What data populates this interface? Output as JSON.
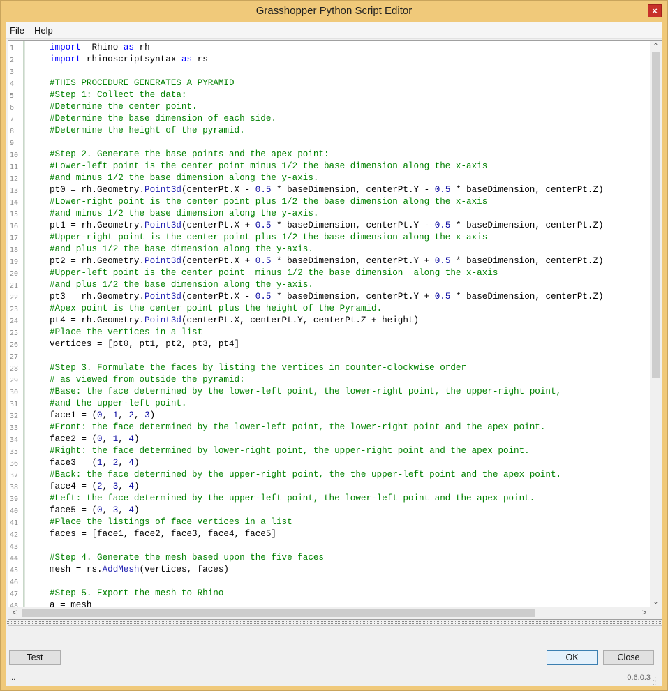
{
  "window": {
    "title": "Grasshopper Python Script Editor",
    "close_glyph": "×"
  },
  "menu": {
    "file": "File",
    "help": "Help"
  },
  "editor": {
    "lines": [
      {
        "n": "1",
        "t": [
          [
            "kw",
            "import"
          ],
          [
            "",
            "  Rhino "
          ],
          [
            "kw",
            "as"
          ],
          [
            "",
            " rh"
          ]
        ]
      },
      {
        "n": "2",
        "t": [
          [
            "kw",
            "import"
          ],
          [
            "",
            " rhinoscriptsyntax "
          ],
          [
            "kw",
            "as"
          ],
          [
            "",
            " rs"
          ]
        ]
      },
      {
        "n": "3",
        "t": []
      },
      {
        "n": "4",
        "t": [
          [
            "cm",
            "#THIS PROCEDURE GENERATES A PYRAMID"
          ]
        ]
      },
      {
        "n": "5",
        "t": [
          [
            "cm",
            "#Step 1: Collect the data:"
          ]
        ]
      },
      {
        "n": "6",
        "t": [
          [
            "cm",
            "#Determine the center point."
          ]
        ]
      },
      {
        "n": "7",
        "t": [
          [
            "cm",
            "#Determine the base dimension of each side."
          ]
        ]
      },
      {
        "n": "8",
        "t": [
          [
            "cm",
            "#Determine the height of the pyramid."
          ]
        ]
      },
      {
        "n": "9",
        "t": []
      },
      {
        "n": "10",
        "t": [
          [
            "cm",
            "#Step 2. Generate the base points and the apex point:"
          ]
        ]
      },
      {
        "n": "11",
        "t": [
          [
            "cm",
            "#Lower-left point is the center point minus 1/2 the base dimension along the x-axis"
          ]
        ]
      },
      {
        "n": "12",
        "t": [
          [
            "cm",
            "#and minus 1/2 the base dimension along the y-axis."
          ]
        ]
      },
      {
        "n": "13",
        "t": [
          [
            "",
            "pt0 = rh.Geometry."
          ],
          [
            "fn",
            "Point3d"
          ],
          [
            "",
            "(centerPt.X - "
          ],
          [
            "num",
            "0.5"
          ],
          [
            "",
            " * baseDimension, centerPt.Y - "
          ],
          [
            "num",
            "0.5"
          ],
          [
            "",
            " * baseDimension, centerPt.Z)"
          ]
        ]
      },
      {
        "n": "14",
        "t": [
          [
            "cm",
            "#Lower-right point is the center point plus 1/2 the base dimension along the x-axis"
          ]
        ]
      },
      {
        "n": "15",
        "t": [
          [
            "cm",
            "#and minus 1/2 the base dimension along the y-axis."
          ]
        ]
      },
      {
        "n": "16",
        "t": [
          [
            "",
            "pt1 = rh.Geometry."
          ],
          [
            "fn",
            "Point3d"
          ],
          [
            "",
            "(centerPt.X + "
          ],
          [
            "num",
            "0.5"
          ],
          [
            "",
            " * baseDimension, centerPt.Y - "
          ],
          [
            "num",
            "0.5"
          ],
          [
            "",
            " * baseDimension, centerPt.Z)"
          ]
        ]
      },
      {
        "n": "17",
        "t": [
          [
            "cm",
            "#Upper-right point is the center point plus 1/2 the base dimension along the x-axis"
          ]
        ]
      },
      {
        "n": "18",
        "t": [
          [
            "cm",
            "#and plus 1/2 the base dimension along the y-axis."
          ]
        ]
      },
      {
        "n": "19",
        "t": [
          [
            "",
            "pt2 = rh.Geometry."
          ],
          [
            "fn",
            "Point3d"
          ],
          [
            "",
            "(centerPt.X + "
          ],
          [
            "num",
            "0.5"
          ],
          [
            "",
            " * baseDimension, centerPt.Y + "
          ],
          [
            "num",
            "0.5"
          ],
          [
            "",
            " * baseDimension, centerPt.Z)"
          ]
        ]
      },
      {
        "n": "20",
        "t": [
          [
            "cm",
            "#Upper-left point is the center point  minus 1/2 the base dimension  along the x-axis"
          ]
        ]
      },
      {
        "n": "21",
        "t": [
          [
            "cm",
            "#and plus 1/2 the base dimension along the y-axis."
          ]
        ]
      },
      {
        "n": "22",
        "t": [
          [
            "",
            "pt3 = rh.Geometry."
          ],
          [
            "fn",
            "Point3d"
          ],
          [
            "",
            "(centerPt.X - "
          ],
          [
            "num",
            "0.5"
          ],
          [
            "",
            " * baseDimension, centerPt.Y + "
          ],
          [
            "num",
            "0.5"
          ],
          [
            "",
            " * baseDimension, centerPt.Z)"
          ]
        ]
      },
      {
        "n": "23",
        "t": [
          [
            "cm",
            "#Apex point is the center point plus the height of the Pyramid."
          ]
        ]
      },
      {
        "n": "24",
        "t": [
          [
            "",
            "pt4 = rh.Geometry."
          ],
          [
            "fn",
            "Point3d"
          ],
          [
            "",
            "(centerPt.X, centerPt.Y, centerPt.Z + height)"
          ]
        ]
      },
      {
        "n": "25",
        "t": [
          [
            "cm",
            "#Place the vertices in a list"
          ]
        ]
      },
      {
        "n": "26",
        "t": [
          [
            "",
            "vertices = [pt0, pt1, pt2, pt3, pt4]"
          ]
        ]
      },
      {
        "n": "27",
        "t": []
      },
      {
        "n": "28",
        "t": [
          [
            "cm",
            "#Step 3. Formulate the faces by listing the vertices in counter-clockwise order"
          ]
        ]
      },
      {
        "n": "29",
        "t": [
          [
            "cm",
            "# as viewed from outside the pyramid:"
          ]
        ]
      },
      {
        "n": "30",
        "t": [
          [
            "cm",
            "#Base: the face determined by the lower-left point, the lower-right point, the upper-right point,"
          ]
        ]
      },
      {
        "n": "31",
        "t": [
          [
            "cm",
            "#and the upper-left point."
          ]
        ]
      },
      {
        "n": "32",
        "t": [
          [
            "",
            "face1 = ("
          ],
          [
            "num",
            "0"
          ],
          [
            "",
            ", "
          ],
          [
            "num",
            "1"
          ],
          [
            "",
            ", "
          ],
          [
            "num",
            "2"
          ],
          [
            "",
            ", "
          ],
          [
            "num",
            "3"
          ],
          [
            "",
            ")"
          ]
        ]
      },
      {
        "n": "33",
        "t": [
          [
            "cm",
            "#Front: the face determined by the lower-left point, the lower-right point and the apex point."
          ]
        ]
      },
      {
        "n": "34",
        "t": [
          [
            "",
            "face2 = ("
          ],
          [
            "num",
            "0"
          ],
          [
            "",
            ", "
          ],
          [
            "num",
            "1"
          ],
          [
            "",
            ", "
          ],
          [
            "num",
            "4"
          ],
          [
            "",
            ")"
          ]
        ]
      },
      {
        "n": "35",
        "t": [
          [
            "cm",
            "#Right: the face determined by lower-right point, the upper-right point and the apex point."
          ]
        ]
      },
      {
        "n": "36",
        "t": [
          [
            "",
            "face3 = ("
          ],
          [
            "num",
            "1"
          ],
          [
            "",
            ", "
          ],
          [
            "num",
            "2"
          ],
          [
            "",
            ", "
          ],
          [
            "num",
            "4"
          ],
          [
            "",
            ")"
          ]
        ]
      },
      {
        "n": "37",
        "t": [
          [
            "cm",
            "#Back: the face determined by the upper-right point, the the upper-left point and the apex point."
          ]
        ]
      },
      {
        "n": "38",
        "t": [
          [
            "",
            "face4 = ("
          ],
          [
            "num",
            "2"
          ],
          [
            "",
            ", "
          ],
          [
            "num",
            "3"
          ],
          [
            "",
            ", "
          ],
          [
            "num",
            "4"
          ],
          [
            "",
            ")"
          ]
        ]
      },
      {
        "n": "39",
        "t": [
          [
            "cm",
            "#Left: the face determined by the upper-left point, the lower-left point and the apex point."
          ]
        ]
      },
      {
        "n": "40",
        "t": [
          [
            "",
            "face5 = ("
          ],
          [
            "num",
            "0"
          ],
          [
            "",
            ", "
          ],
          [
            "num",
            "3"
          ],
          [
            "",
            ", "
          ],
          [
            "num",
            "4"
          ],
          [
            "",
            ")"
          ]
        ]
      },
      {
        "n": "41",
        "t": [
          [
            "cm",
            "#Place the listings of face vertices in a list"
          ]
        ]
      },
      {
        "n": "42",
        "t": [
          [
            "",
            "faces = [face1, face2, face3, face4, face5]"
          ]
        ]
      },
      {
        "n": "43",
        "t": []
      },
      {
        "n": "44",
        "t": [
          [
            "cm",
            "#Step 4. Generate the mesh based upon the five faces"
          ]
        ]
      },
      {
        "n": "45",
        "t": [
          [
            "",
            "mesh = rs."
          ],
          [
            "fn",
            "AddMesh"
          ],
          [
            "",
            "(vertices, faces)"
          ]
        ]
      },
      {
        "n": "46",
        "t": []
      },
      {
        "n": "47",
        "t": [
          [
            "cm",
            "#Step 5. Export the mesh to Rhino"
          ]
        ]
      },
      {
        "n": "48",
        "t": [
          [
            "",
            "a = mesh"
          ]
        ]
      }
    ],
    "scroll_up_glyph": "⌃",
    "scroll_down_glyph": "⌄",
    "scroll_left_glyph": "<",
    "scroll_right_glyph": ">"
  },
  "buttons": {
    "test": "Test",
    "ok": "OK",
    "close": "Close"
  },
  "status": {
    "left": "...",
    "version": "0.6.0.3"
  },
  "colors": {
    "title_bar": "#f0c97a",
    "comment": "#008000",
    "keyword": "#0000ff",
    "close_button": "#c7302a"
  }
}
